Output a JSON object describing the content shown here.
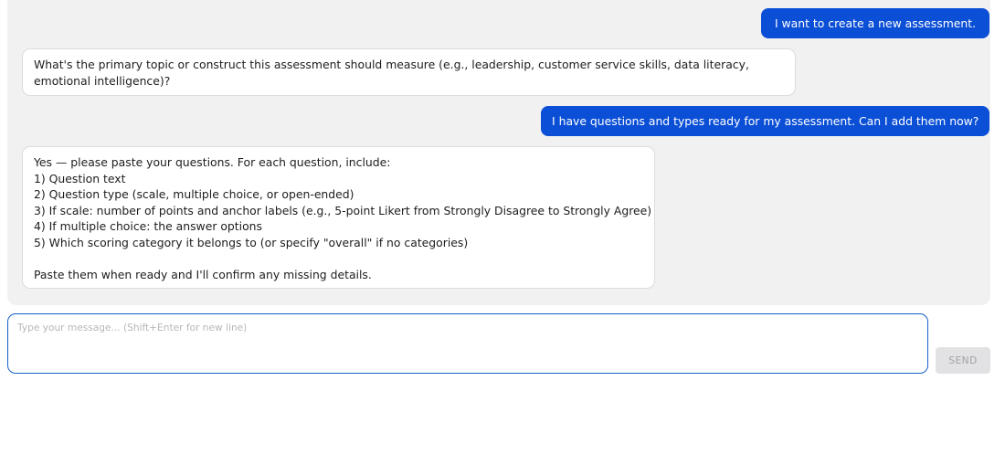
{
  "messages": [
    {
      "role": "user",
      "text": "I want to create a new assessment."
    },
    {
      "role": "assistant",
      "lines": [
        "What's the primary topic or construct this assessment should measure (e.g., leadership, customer service skills, data literacy, emotional intelligence)?"
      ]
    },
    {
      "role": "user",
      "text": "I have questions and types ready for my assessment. Can I add them now?"
    },
    {
      "role": "assistant",
      "lines": [
        "Yes — please paste your questions. For each question, include:",
        "1) Question text",
        "2) Question type (scale, multiple choice, or open-ended)",
        "3) If scale: number of points and anchor labels (e.g., 5-point Likert from Strongly Disagree to Strongly Agree)",
        "4) If multiple choice: the answer options",
        "5) Which scoring category it belongs to (or specify \"overall\" if no categories)",
        "",
        "Paste them when ready and I'll confirm any missing details."
      ]
    }
  ],
  "composer": {
    "placeholder": "Type your message... (Shift+Enter for new line)",
    "value": ""
  },
  "send_button": {
    "label": "SEND",
    "enabled": false
  },
  "colors": {
    "user_bubble": "#0b4fd6",
    "chat_background": "#f1f1f2",
    "input_border": "#1560c7",
    "send_disabled": "#e2e2e4"
  }
}
